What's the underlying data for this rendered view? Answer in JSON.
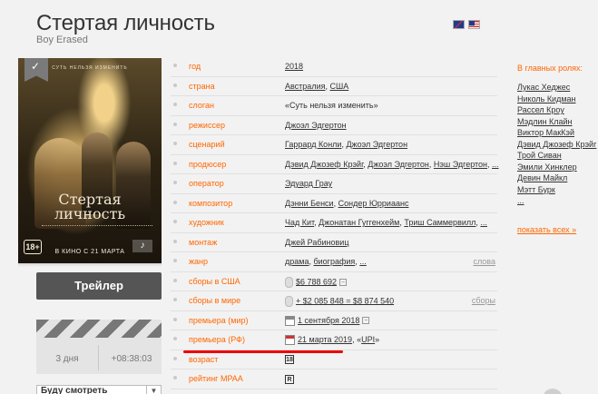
{
  "header": {
    "title": "Стертая личность",
    "original_title": "Boy Erased"
  },
  "poster": {
    "tagline": "СУТЬ НЕЛЬЗЯ ИЗМЕНИТЬ",
    "title_line1": "Стертая",
    "title_line2": "личность",
    "release_text": "В КИНО С 21 МАРТА",
    "age": "18+"
  },
  "actions": {
    "trailer_label": "Трейлер",
    "countdown_days": "3 дня",
    "countdown_time": "+08:38:03",
    "will_watch_label": "Буду смотреть"
  },
  "info": {
    "rows": [
      {
        "label": "год",
        "links": [
          "2018"
        ]
      },
      {
        "label": "страна",
        "links": [
          "Австралия",
          "США"
        ]
      },
      {
        "label": "слоган",
        "text": "«Суть нельзя изменить»"
      },
      {
        "label": "режиссер",
        "links": [
          "Джоэл Эдгертон"
        ]
      },
      {
        "label": "сценарий",
        "links": [
          "Гаррард Конли",
          "Джоэл Эдгертон"
        ]
      },
      {
        "label": "продюсер",
        "links": [
          "Дэвид Джозеф Крэйг",
          "Джоэл Эдгертон",
          "Нэш Эдгертон",
          "..."
        ]
      },
      {
        "label": "оператор",
        "links": [
          "Эдуард Грау"
        ]
      },
      {
        "label": "композитор",
        "links": [
          "Дэнни Бенси",
          "Сондер Юрриаанс"
        ]
      },
      {
        "label": "художник",
        "links": [
          "Чад Кит",
          "Джонатан Гуггенхейм",
          "Триш Саммервилл",
          "..."
        ]
      },
      {
        "label": "монтаж",
        "links": [
          "Джей Рабиновиц"
        ]
      },
      {
        "label": "жанр",
        "links": [
          "драма",
          "биография",
          "..."
        ],
        "right": "слова"
      },
      {
        "label": "сборы в США",
        "text": "$6 788 692",
        "right": ""
      },
      {
        "label": "сборы в мире",
        "text": "+ $2 085 848 = $8 874 540",
        "right": "сборы"
      },
      {
        "label": "премьера (мир)",
        "text": "1 сентября 2018"
      },
      {
        "label": "премьера (РФ)",
        "text": "21 марта 2019",
        "extra_open": ", «",
        "extra_link": "UPI",
        "extra_close": "»"
      },
      {
        "label": "возраст",
        "badge": "18"
      },
      {
        "label": "рейтинг MPAA",
        "badge": "R"
      }
    ]
  },
  "cast": {
    "title": "В главных ролях:",
    "actors": [
      "Лукас Хеджес",
      "Николь Кидман",
      "Рассел Кроу",
      "Мэдлин Клайн",
      "Виктор МакКэй",
      "Дэвид Джозеф Крэйг",
      "Трой Сиван",
      "Эмили Хинклер",
      "Девин Майкл",
      "Мэтт Бурк",
      "..."
    ],
    "show_all": "показать всех »"
  },
  "colors": {
    "accent": "#ff6600",
    "underline_highlight": "#e00000",
    "button_bg": "#555555"
  }
}
